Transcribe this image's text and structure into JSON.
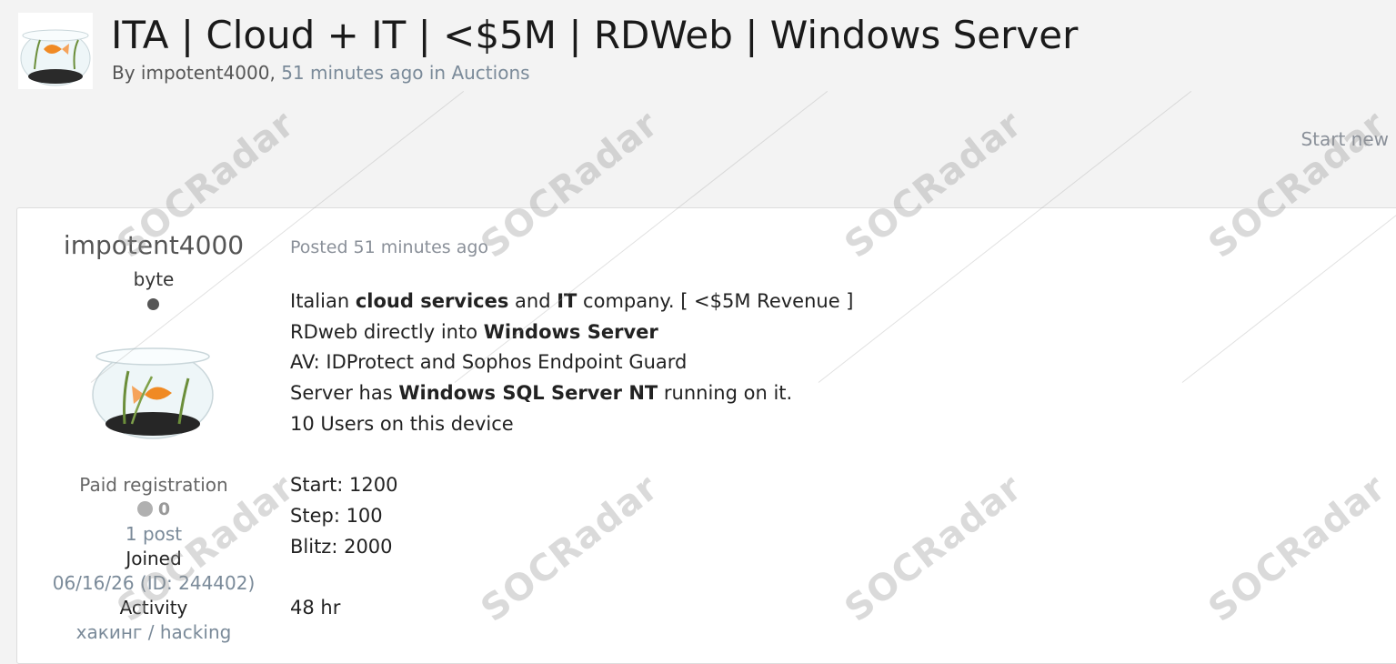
{
  "thread": {
    "title": "ITA | Cloud + IT | <$5M | RDWeb | Windows Server",
    "meta_prefix": "By",
    "author": "impotent4000",
    "meta_separator": ",",
    "time": "51 minutes ago",
    "in_word": "in",
    "forum": "Auctions",
    "avatar_icon": "goldfish-bowl-icon"
  },
  "toolbar": {
    "start_new": "Start new"
  },
  "post": {
    "author": {
      "name": "impotent4000",
      "rank": "byte",
      "status_color": "#555555",
      "avatar_icon": "goldfish-bowl-icon",
      "group": "Paid registration",
      "reputation": "0",
      "posts": "1 post",
      "joined_label": "Joined",
      "joined_value": "06/16/26 (ID: 244402)",
      "activity_label": "Activity",
      "activity_value": "хакинг / hacking"
    },
    "date": "Posted 51 minutes ago",
    "body": {
      "line1": {
        "t1": "Italian ",
        "b1": "cloud services",
        "t2": " and ",
        "b2": "IT",
        "t3": " company. [ <$5M Revenue ]"
      },
      "line2": {
        "t1": "RDweb directly into ",
        "b1": "Windows Server"
      },
      "line3": "AV: IDProtect and Sophos Endpoint Guard",
      "line4": {
        "t1": "Server has ",
        "b1": "Windows SQL Server NT",
        "t2": " running on it."
      },
      "line5": "10 Users on this device",
      "start": "Start: 1200",
      "step": "Step: 100",
      "blitz": "Blitz: 2000",
      "duration": "48 hr"
    }
  },
  "watermark": {
    "text": "SOCRadar"
  },
  "colors": {
    "background": "#f3f3f3",
    "card": "#ffffff",
    "muted_link": "#7a8a99"
  }
}
